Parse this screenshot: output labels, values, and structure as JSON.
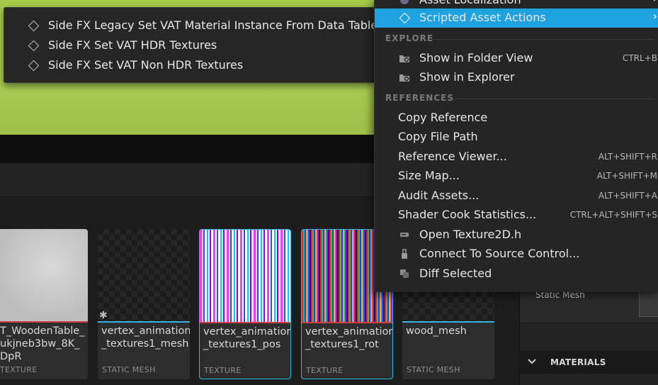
{
  "popup": {
    "items": [
      "Side FX Legacy Set VAT Material Instance From Data Table",
      "Side FX Set VAT HDR Textures",
      "Side FX Set VAT Non HDR Textures"
    ]
  },
  "menu": {
    "top_items": [
      {
        "label": "Asset Localization",
        "submenu": true
      },
      {
        "label": "Scripted Asset Actions",
        "submenu": true,
        "highlighted": true
      }
    ],
    "sections": {
      "explore": "EXPLORE",
      "references": "REFERENCES"
    },
    "explore_items": [
      {
        "label": "Show in Folder View",
        "shortcut": "CTRL+B",
        "icon": "folder-search-icon"
      },
      {
        "label": "Show in Explorer",
        "shortcut": "",
        "icon": "folder-search-icon"
      }
    ],
    "reference_items": [
      {
        "label": "Copy Reference",
        "shortcut": ""
      },
      {
        "label": "Copy File Path",
        "shortcut": ""
      },
      {
        "label": "Reference Viewer...",
        "shortcut": "ALT+SHIFT+R"
      },
      {
        "label": "Size Map...",
        "shortcut": "ALT+SHIFT+M"
      },
      {
        "label": "Audit Assets...",
        "shortcut": "ALT+SHIFT+A"
      },
      {
        "label": "Shader Cook Statistics...",
        "shortcut": "CTRL+ALT+SHIFT+S"
      }
    ],
    "misc_items": [
      {
        "label": "Open Texture2D.h",
        "icon": "code-file-icon"
      },
      {
        "label": "Connect To Source Control...",
        "icon": "source-control-icon"
      },
      {
        "label": "Diff Selected",
        "icon": "diff-icon"
      }
    ]
  },
  "assets": [
    {
      "name": "T_WoodenTable_\nukjneb3bw_8K_\nDpR",
      "type": "TEXTURE",
      "bar_color": "#d04040"
    },
    {
      "name": "vertex_animation\n_textures1_mesh",
      "type": "STATIC MESH",
      "bar_color": "#35b4e6"
    },
    {
      "name": "vertex_animation\n_textures1_pos",
      "type": "TEXTURE",
      "bar_color": "#d04040"
    },
    {
      "name": "vertex_animation\n_textures1_rot",
      "type": "TEXTURE",
      "bar_color": "#d04040"
    },
    {
      "name": "wood_mesh",
      "type": "STATIC MESH",
      "bar_color": "#35b4e6"
    }
  ],
  "details": {
    "static_mesh_label": "Static Mesh",
    "materials_header": "MATERIALS"
  },
  "colors": {
    "highlight": "#1fa3e0",
    "selection": "#35b4e6"
  }
}
